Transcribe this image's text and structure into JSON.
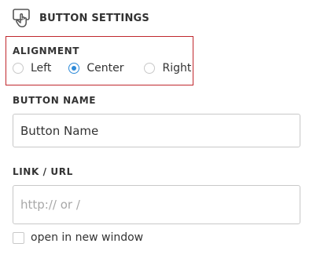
{
  "header": {
    "title": "BUTTON SETTINGS",
    "icon": "button-cursor-icon"
  },
  "alignment": {
    "label": "ALIGNMENT",
    "options": [
      {
        "label": "Left",
        "checked": false
      },
      {
        "label": "Center",
        "checked": true
      },
      {
        "label": "Right",
        "checked": false
      }
    ],
    "highlight_color": "#c0272d",
    "selected_color": "#2d8ad8"
  },
  "button_name": {
    "label": "BUTTON NAME",
    "value": "Button Name"
  },
  "link": {
    "label": "LINK / URL",
    "value": "",
    "placeholder": "http:// or /"
  },
  "new_window": {
    "label": "open in new window",
    "checked": false
  }
}
